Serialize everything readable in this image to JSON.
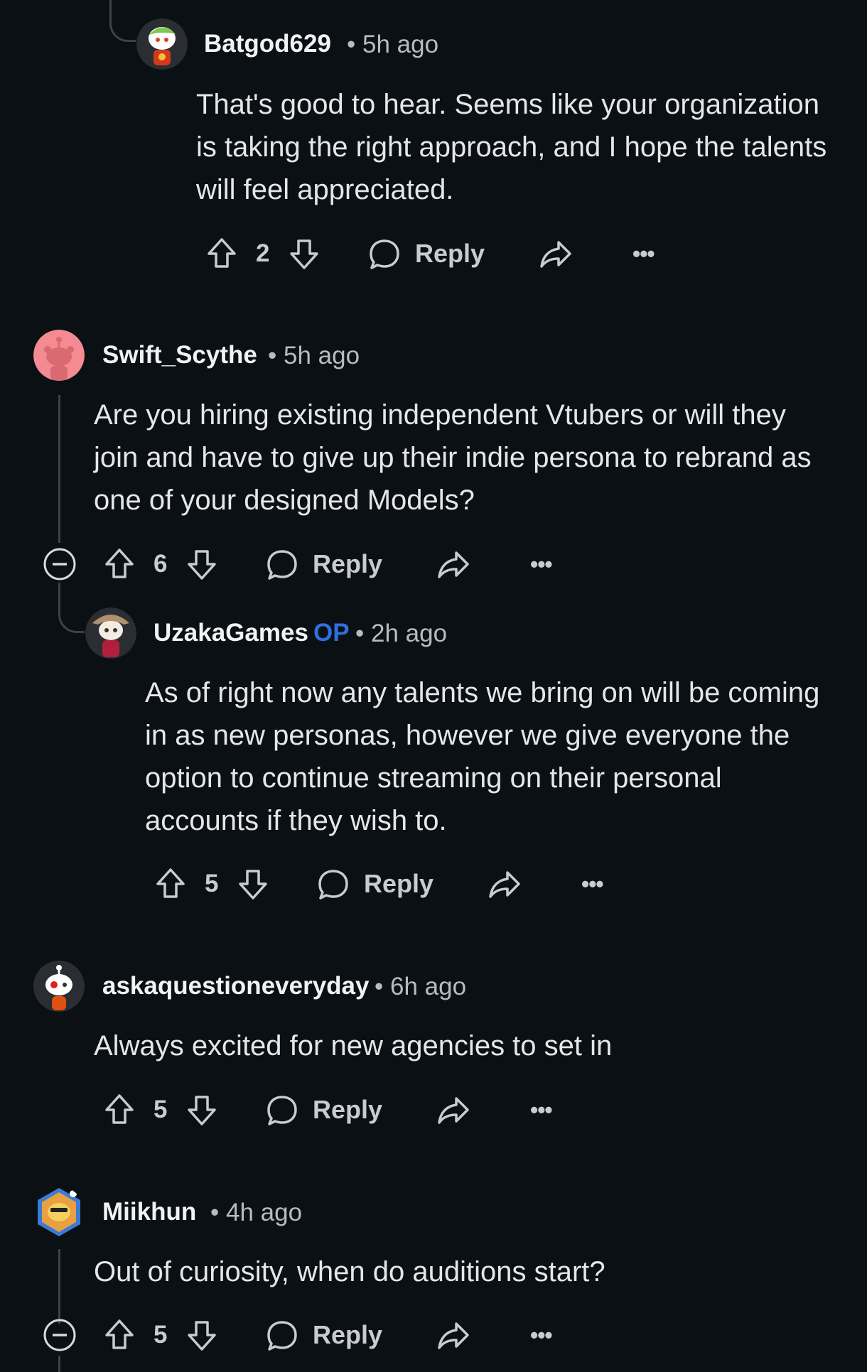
{
  "comments": [
    {
      "username": "Batgod629",
      "time": "• 5h ago",
      "body": "That's good to hear. Seems like your organization is taking the right approach, and I hope the talents will feel appreciated.",
      "votes": "2",
      "reply_label": "Reply"
    },
    {
      "username": "Swift_Scythe",
      "time": "• 5h ago",
      "body": "Are you hiring existing independent Vtubers or will they join and have to give up their indie persona to rebrand as one of your designed Models?",
      "votes": "6",
      "reply_label": "Reply"
    },
    {
      "username": "UzakaGames",
      "op_badge": "OP",
      "time": "• 2h ago",
      "body": "As of right now any talents we bring on will be coming in as new personas, however we give everyone the option to continue streaming on their personal accounts if they wish to.",
      "votes": "5",
      "reply_label": "Reply"
    },
    {
      "username": "askaquestioneveryday",
      "time": "• 6h ago",
      "body": "Always excited for new agencies to set in",
      "votes": "5",
      "reply_label": "Reply"
    },
    {
      "username": "Miikhun",
      "time": "• 4h ago",
      "body": "Out of curiosity, when do auditions start?",
      "votes": "5",
      "reply_label": "Reply"
    }
  ],
  "more_label": "•••",
  "icons": {
    "upvote": "arrow-up-icon",
    "downvote": "arrow-down-icon",
    "reply": "speech-bubble-icon",
    "share": "share-arrow-icon",
    "more": "ellipsis-icon",
    "collapse": "collapse-minus-icon"
  },
  "colors": {
    "background": "#0b1014",
    "op_badge": "#2f6fe0",
    "thread_line": "#3e4246"
  }
}
